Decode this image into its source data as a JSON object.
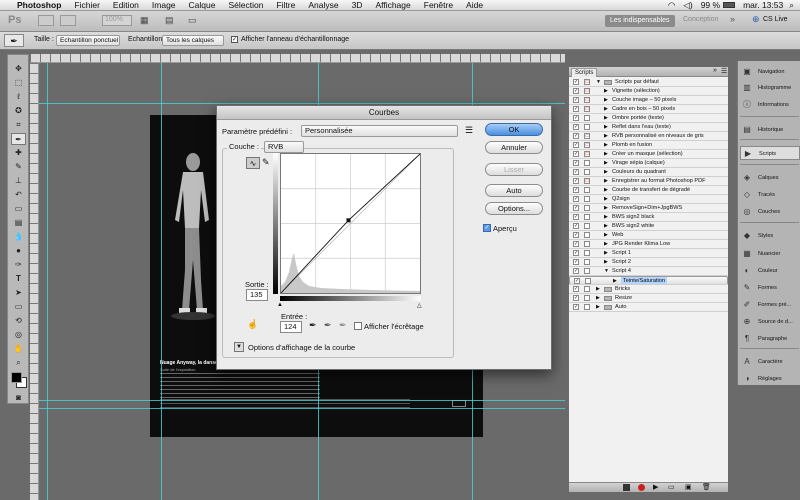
{
  "menubar": {
    "apple": "",
    "items": [
      "Photoshop",
      "Fichier",
      "Edition",
      "Image",
      "Calque",
      "Sélection",
      "Filtre",
      "Analyse",
      "3D",
      "Affichage",
      "Fenêtre",
      "Aide"
    ],
    "battery": "99 %",
    "clock": "mar. 13:53"
  },
  "appbar": {
    "logo": "Ps",
    "zoom": "100%",
    "workspace_active": "Les indispensables",
    "workspace_other": "Conception",
    "more": "»",
    "cs_live": "CS Live"
  },
  "options": {
    "taille_label": "Taille :",
    "taille_value": "Echantillon ponctuel",
    "echantillon_label": "Echantillon :",
    "echantillon_value": "Tous les calques",
    "anneau_label": "Afficher l'anneau d'échantillonnage"
  },
  "document": {
    "caption_title": "Nuage Anyway, la danse en clair-obscur",
    "caption_sub": "Suite de l'exposition"
  },
  "curves": {
    "title": "Courbes",
    "preset_label": "Paramètre prédéfini :",
    "preset_value": "Personnalisée",
    "channel_label": "Couche :",
    "channel_value": "RVB",
    "output_label": "Sortie :",
    "output_value": "135",
    "input_label": "Entrée :",
    "input_value": "124",
    "clip_label": "Afficher l'écrêtage",
    "options_label": "Options d'affichage de la courbe",
    "ok": "OK",
    "cancel": "Annuler",
    "smooth": "Lisser",
    "auto": "Auto",
    "options": "Options...",
    "preview": "Aperçu"
  },
  "scripts": {
    "tab": "Scripts",
    "items": [
      {
        "name": "Scripts par défaut",
        "folder": true,
        "open": true,
        "dialog": true,
        "indent": 0
      },
      {
        "name": "Vignette (sélection)",
        "dialog": true,
        "indent": 1
      },
      {
        "name": "Couche image – 50 pixels",
        "dialog": true,
        "indent": 1
      },
      {
        "name": "Cadre en bois – 50 pixels",
        "dialog": true,
        "indent": 1
      },
      {
        "name": "Ombre portée (texte)",
        "dialog": false,
        "indent": 1
      },
      {
        "name": "Reflet dans l'eau (texte)",
        "dialog": false,
        "indent": 1
      },
      {
        "name": "RVB personnalisé en niveaux de gris",
        "dialog": true,
        "indent": 1
      },
      {
        "name": "Plomb en fusion",
        "dialog": true,
        "indent": 1
      },
      {
        "name": "Créer un masque (sélection)",
        "dialog": true,
        "indent": 1
      },
      {
        "name": "Virage sépia (calque)",
        "dialog": false,
        "indent": 1
      },
      {
        "name": "Couleurs du quadrant",
        "dialog": false,
        "indent": 1
      },
      {
        "name": "Enregistrer au format Photoshop PDF",
        "dialog": true,
        "indent": 1
      },
      {
        "name": "Courbe de transfert de dégradé",
        "dialog": false,
        "indent": 1
      },
      {
        "name": "Q2sign",
        "dialog": false,
        "indent": 1
      },
      {
        "name": "RemoveSign+Dim+JpgBWS",
        "dialog": false,
        "indent": 1
      },
      {
        "name": "BWS sign2 black",
        "dialog": false,
        "indent": 1
      },
      {
        "name": "BWS sign2 white",
        "dialog": false,
        "indent": 1
      },
      {
        "name": "Web",
        "dialog": false,
        "indent": 1
      },
      {
        "name": "JPG Render Klima Low",
        "dialog": false,
        "indent": 1
      },
      {
        "name": "Script 1",
        "dialog": false,
        "indent": 1
      },
      {
        "name": "Script 2",
        "dialog": false,
        "indent": 1
      },
      {
        "name": "Script 4",
        "dialog": false,
        "indent": 1,
        "open": true
      },
      {
        "name": "Teinte/Saturation",
        "dialog": false,
        "indent": 2,
        "selected": true
      },
      {
        "name": "Bricks",
        "folder": true,
        "dialog": false,
        "indent": 0
      },
      {
        "name": "Resize",
        "folder": true,
        "dialog": false,
        "indent": 0
      },
      {
        "name": "Auto",
        "folder": true,
        "dialog": false,
        "indent": 0
      }
    ]
  },
  "dock": {
    "items": [
      {
        "label": "Navigation",
        "icon": "navigator-icon",
        "glyph": "▣"
      },
      {
        "label": "Histogramme",
        "icon": "histogram-icon",
        "glyph": "▥"
      },
      {
        "label": "Informations",
        "icon": "info-icon",
        "glyph": "ⓘ"
      },
      {
        "label": "Historique",
        "icon": "history-icon",
        "glyph": "▤"
      },
      {
        "label": "Scripts",
        "icon": "actions-icon",
        "glyph": "▶",
        "active": true
      },
      {
        "label": "Calques",
        "icon": "layers-icon",
        "glyph": "◈"
      },
      {
        "label": "Tracés",
        "icon": "paths-icon",
        "glyph": "◇"
      },
      {
        "label": "Couches",
        "icon": "channels-icon",
        "glyph": "◎"
      },
      {
        "label": "Styles",
        "icon": "styles-icon",
        "glyph": "◆"
      },
      {
        "label": "Nuancier",
        "icon": "swatches-icon",
        "glyph": "▦"
      },
      {
        "label": "Couleur",
        "icon": "color-icon",
        "glyph": "◐"
      },
      {
        "label": "Formes",
        "icon": "brushes-icon",
        "glyph": "✎"
      },
      {
        "label": "Formes pré...",
        "icon": "brush-presets-icon",
        "glyph": "✐"
      },
      {
        "label": "Source de d...",
        "icon": "clone-source-icon",
        "glyph": "⊕"
      },
      {
        "label": "Paragraphe",
        "icon": "paragraph-icon",
        "glyph": "¶"
      },
      {
        "label": "Caractère",
        "icon": "character-icon",
        "glyph": "A"
      },
      {
        "label": "Réglages",
        "icon": "adjustments-icon",
        "glyph": "◑"
      }
    ]
  },
  "colors": {
    "guide": "#46d7d7",
    "ok_button": "#4a8fe0",
    "selected_row": "#b5d5ff",
    "dialog_icon": "#c02020"
  }
}
